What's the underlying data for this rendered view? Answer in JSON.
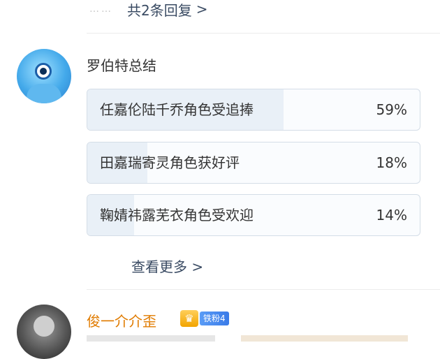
{
  "replies": {
    "dots": "……",
    "label": "共2条回复",
    "chevron": ">"
  },
  "bot": {
    "avatar_icon": "robot-avatar",
    "name": "罗伯特总结"
  },
  "options": [
    {
      "label": "任嘉伦陆千乔角色受追捧",
      "percent": "59%",
      "fill": 0.59
    },
    {
      "label": "田嘉瑞寄灵角色获好评",
      "percent": "18%",
      "fill": 0.18
    },
    {
      "label": "鞠婧祎露芜衣角色受欢迎",
      "percent": "14%",
      "fill": 0.14
    }
  ],
  "more": {
    "label": "查看更多",
    "chevron": ">"
  },
  "user": {
    "name": "俊一介介歪",
    "badge_icon": "crown-icon",
    "badge_text": "铁粉4",
    "badge_color": "#3a7be8"
  },
  "colors": {
    "link": "#3a4b63",
    "username": "#e07b00",
    "bar_fill": "#e9f0f7",
    "border": "#d4dde7"
  }
}
